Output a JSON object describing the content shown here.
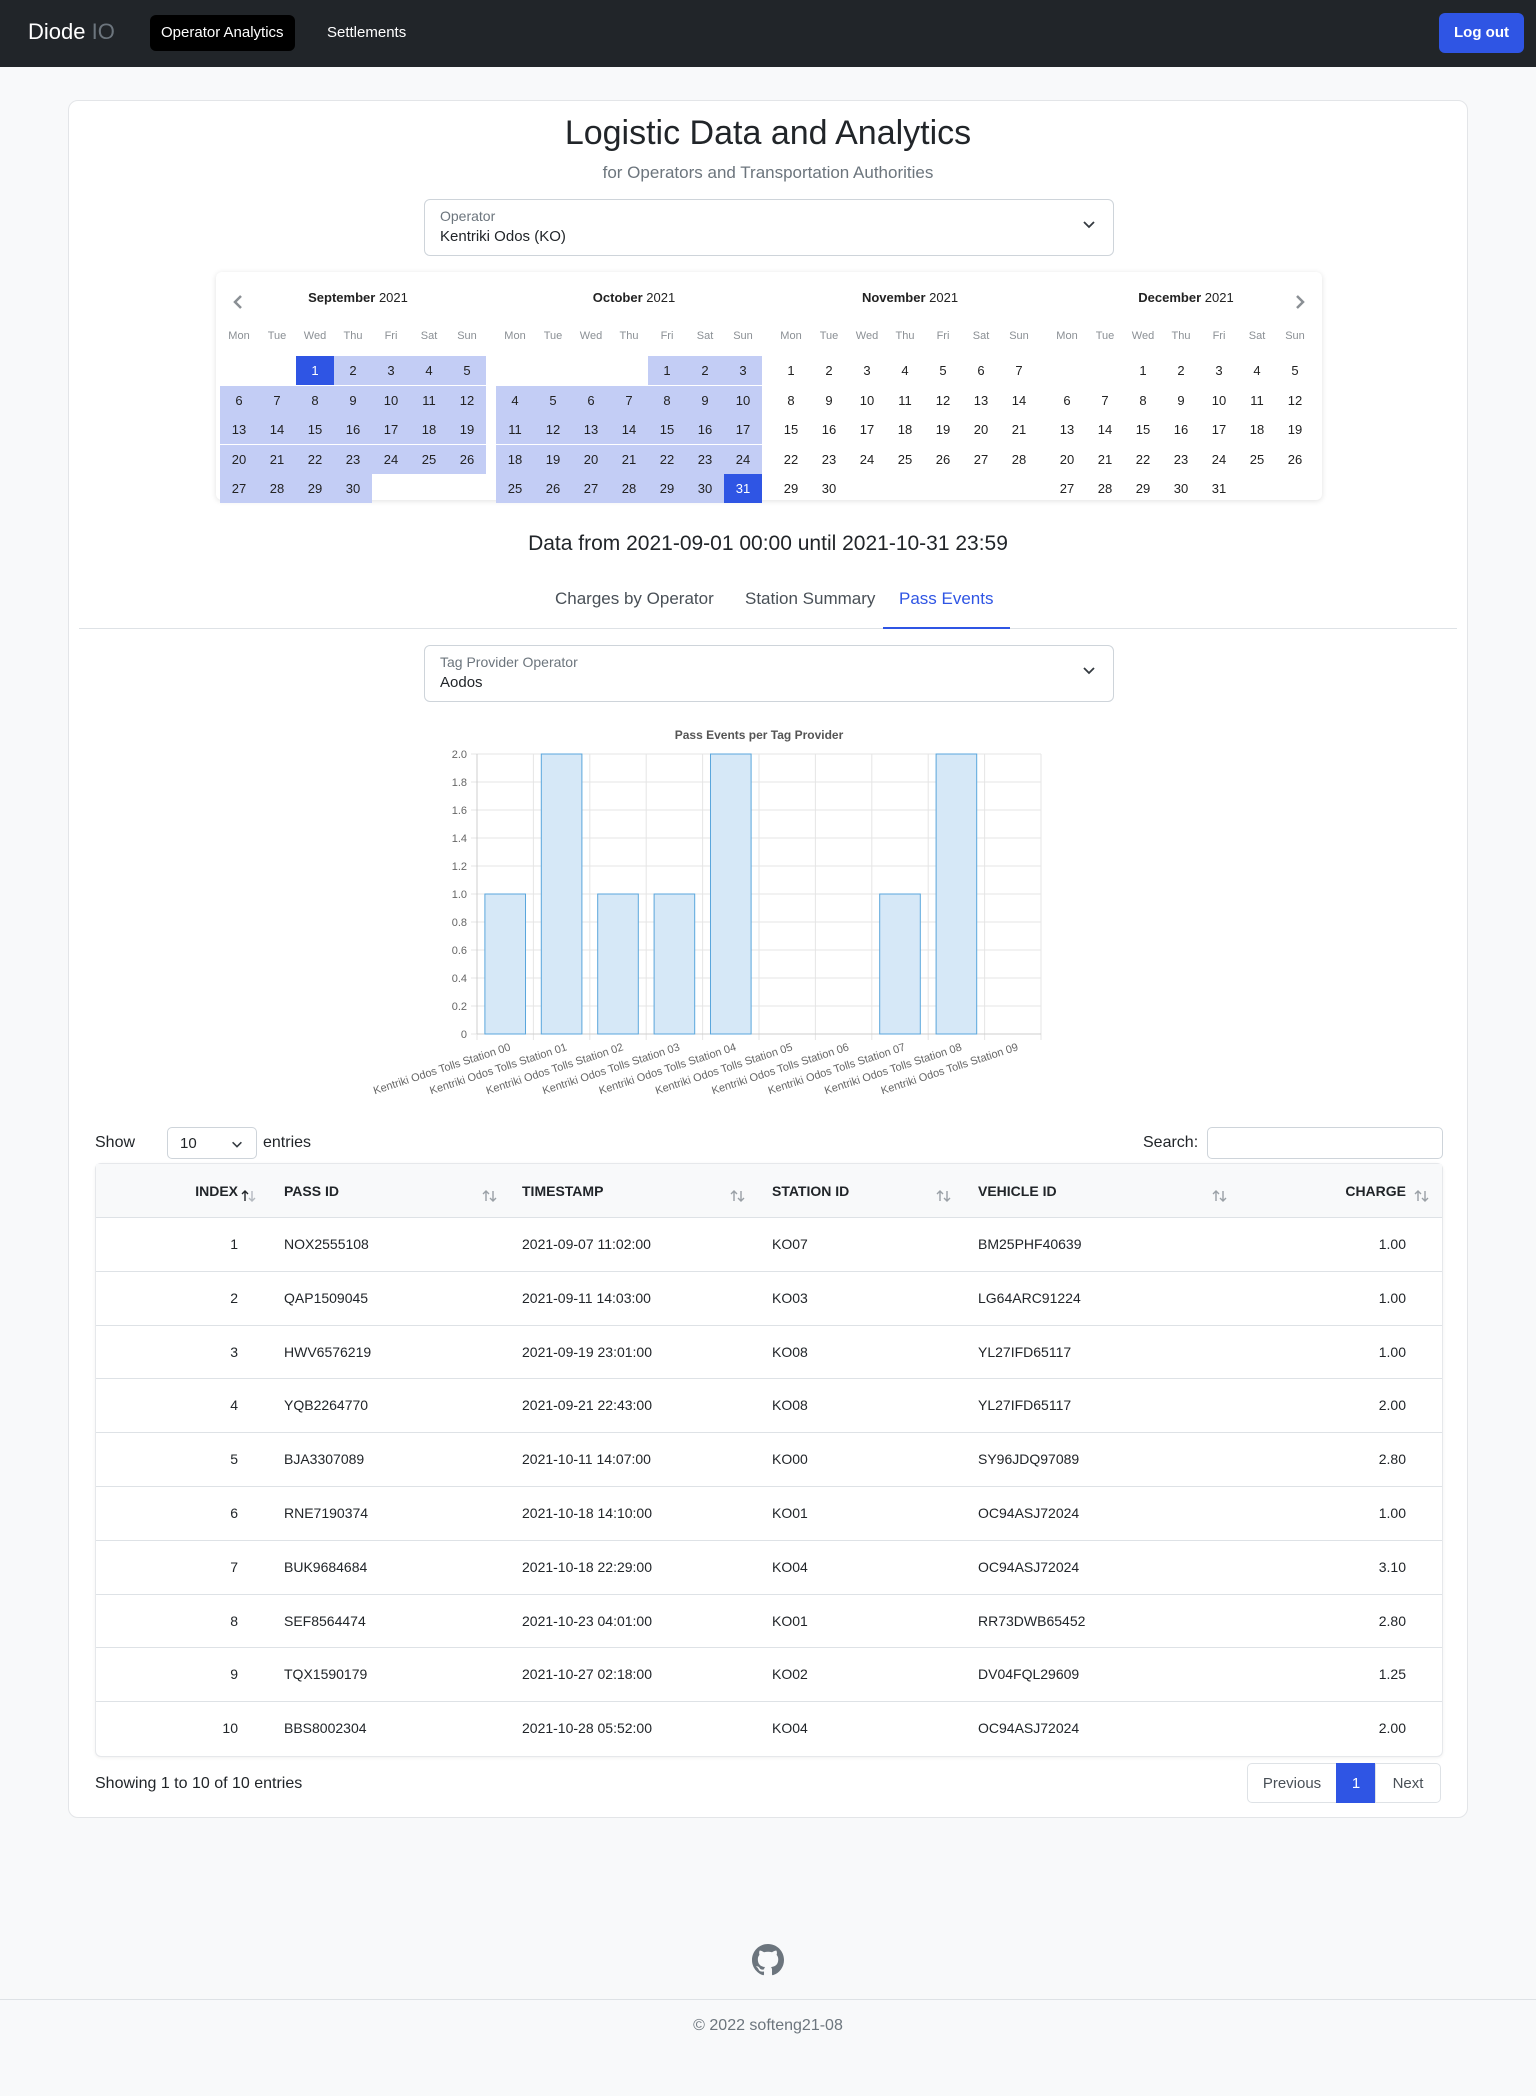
{
  "nav": {
    "brand_main": "Diode",
    "brand_suffix": " IO",
    "items": [
      {
        "label": "Operator Analytics"
      },
      {
        "label": "Settlements"
      }
    ],
    "logout_label": "Log out"
  },
  "header": {
    "title": "Logistic Data and Analytics",
    "subtitle": "for Operators and Transportation Authorities"
  },
  "operator_select": {
    "label": "Operator",
    "value": "Kentriki Odos (KO)"
  },
  "calendar": {
    "weekdays": [
      "Mon",
      "Tue",
      "Wed",
      "Thu",
      "Fri",
      "Sat",
      "Sun"
    ],
    "months": [
      {
        "name": "September",
        "year": "2021",
        "start_weekday": 2,
        "days": 30
      },
      {
        "name": "October",
        "year": "2021",
        "start_weekday": 4,
        "days": 31
      },
      {
        "name": "November",
        "year": "2021",
        "start_weekday": 0,
        "days": 30
      },
      {
        "name": "December",
        "year": "2021",
        "start_weekday": 2,
        "days": 31
      }
    ],
    "selected_start": "2021-09-01",
    "selected_end": "2021-10-31",
    "accent_color": "#2f55e4",
    "range_color": "#c3cdf5"
  },
  "range_text": "Data from 2021-09-01 00:00 until 2021-10-31 23:59",
  "tabs": [
    {
      "label": "Charges by Operator",
      "active": false
    },
    {
      "label": "Station Summary",
      "active": false
    },
    {
      "label": "Pass Events",
      "active": true
    }
  ],
  "tag_provider_select": {
    "label": "Tag Provider Operator",
    "value": "Aodos"
  },
  "chart_data": {
    "type": "bar",
    "title": "Pass Events per Tag Provider",
    "categories": [
      "Kentriki Odos Tolls Station 00",
      "Kentriki Odos Tolls Station 01",
      "Kentriki Odos Tolls Station 02",
      "Kentriki Odos Tolls Station 03",
      "Kentriki Odos Tolls Station 04",
      "Kentriki Odos Tolls Station 05",
      "Kentriki Odos Tolls Station 06",
      "Kentriki Odos Tolls Station 07",
      "Kentriki Odos Tolls Station 08",
      "Kentriki Odos Tolls Station 09"
    ],
    "values": [
      1,
      2,
      1,
      1,
      2,
      0,
      0,
      1,
      2,
      0
    ],
    "ylim": [
      0,
      2
    ],
    "yticks": [
      "0",
      "0.2",
      "0.4",
      "0.6",
      "0.8",
      "1.0",
      "1.2",
      "1.4",
      "1.6",
      "1.8",
      "2.0"
    ],
    "grid": true,
    "bar_fill": "#d6e8f7",
    "bar_stroke": "#5aa6dc"
  },
  "table_controls": {
    "show_label": "Show",
    "page_size": "10",
    "entries_label": "entries",
    "search_label": "Search:"
  },
  "table": {
    "columns": [
      "INDEX",
      "PASS ID",
      "TIMESTAMP",
      "STATION ID",
      "VEHICLE ID",
      "CHARGE"
    ],
    "rows": [
      [
        "1",
        "NOX2555108",
        "2021-09-07 11:02:00",
        "KO07",
        "BM25PHF40639",
        "1.00"
      ],
      [
        "2",
        "QAP1509045",
        "2021-09-11 14:03:00",
        "KO03",
        "LG64ARC91224",
        "1.00"
      ],
      [
        "3",
        "HWV6576219",
        "2021-09-19 23:01:00",
        "KO08",
        "YL27IFD65117",
        "1.00"
      ],
      [
        "4",
        "YQB2264770",
        "2021-09-21 22:43:00",
        "KO08",
        "YL27IFD65117",
        "2.00"
      ],
      [
        "5",
        "BJA3307089",
        "2021-10-11 14:07:00",
        "KO00",
        "SY96JDQ97089",
        "2.80"
      ],
      [
        "6",
        "RNE7190374",
        "2021-10-18 14:10:00",
        "KO01",
        "OC94ASJ72024",
        "1.00"
      ],
      [
        "7",
        "BUK9684684",
        "2021-10-18 22:29:00",
        "KO04",
        "OC94ASJ72024",
        "3.10"
      ],
      [
        "8",
        "SEF8564474",
        "2021-10-23 04:01:00",
        "KO01",
        "RR73DWB65452",
        "2.80"
      ],
      [
        "9",
        "TQX1590179",
        "2021-10-27 02:18:00",
        "KO02",
        "DV04FQL29609",
        "1.25"
      ],
      [
        "10",
        "BBS8002304",
        "2021-10-28 05:52:00",
        "KO04",
        "OC94ASJ72024",
        "2.00"
      ]
    ]
  },
  "pagination": {
    "info": "Showing 1 to 10 of 10 entries",
    "previous": "Previous",
    "current": "1",
    "next": "Next"
  },
  "footer": {
    "icon": "github-icon",
    "copyright": "© 2022 softeng21-08"
  }
}
